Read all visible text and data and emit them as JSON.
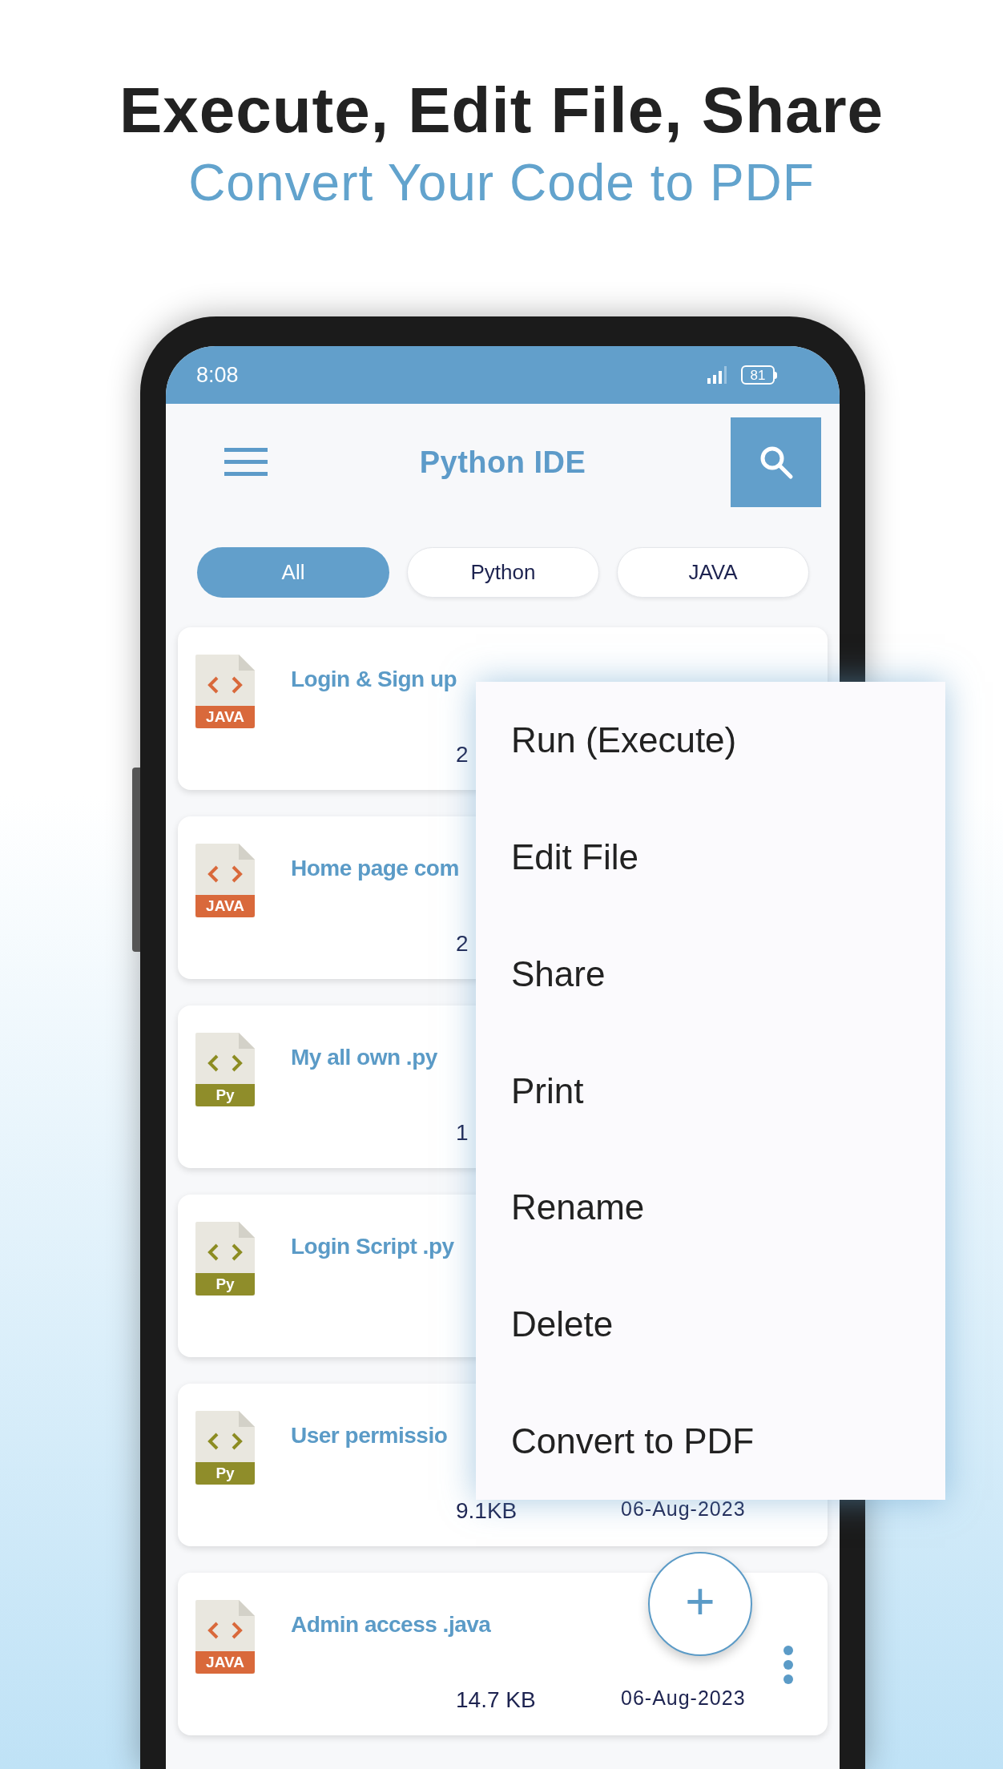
{
  "headline": "Execute, Edit File, Share",
  "subheadline": "Convert Your Code to PDF",
  "status_bar": {
    "time": "8:08",
    "battery": "81"
  },
  "app_bar": {
    "title": "Python IDE"
  },
  "filters": [
    {
      "label": "All",
      "selected": true
    },
    {
      "label": "Python",
      "selected": false
    },
    {
      "label": "JAVA",
      "selected": false
    }
  ],
  "files": [
    {
      "kind": "java",
      "badge": "JAVA",
      "name": "Login & Sign up",
      "size": "2"
    },
    {
      "kind": "java",
      "badge": "JAVA",
      "name": "Home page com",
      "size": "2"
    },
    {
      "kind": "py",
      "badge": "Py",
      "name": "My all own .py",
      "size": "1"
    },
    {
      "kind": "py",
      "badge": "Py",
      "name": "Login Script .py"
    },
    {
      "kind": "py",
      "badge": "Py",
      "name": "User permissio",
      "size": "9.1KB",
      "date": "06-Aug-2023"
    },
    {
      "kind": "java",
      "badge": "JAVA",
      "name": "Admin access .java",
      "size": "14.7 KB",
      "date": "06-Aug-2023",
      "more": true
    }
  ],
  "context_menu": [
    "Run (Execute)",
    "Edit File",
    "Share",
    "Print",
    "Rename",
    "Delete",
    "Convert to PDF"
  ],
  "fab": {
    "label": "+"
  }
}
